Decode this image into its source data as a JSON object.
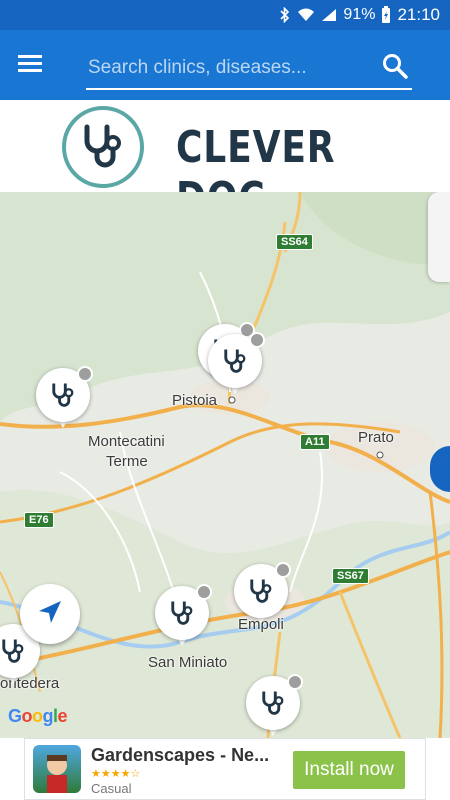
{
  "status_bar": {
    "battery": "91%",
    "time": "21:10",
    "icons": [
      "bluetooth-icon",
      "wifi-icon",
      "signal-icon",
      "battery-charging-icon"
    ]
  },
  "app_bar": {
    "menu_icon": "hamburger-menu-icon",
    "search_placeholder": "Search clinics, diseases...",
    "search_icon": "search-icon",
    "color": "#1976d2"
  },
  "logo": {
    "title": "CLEVER DOC",
    "accent": "#5aa7a6",
    "text_color": "#213748"
  },
  "map": {
    "places": [
      "Pistoia",
      "Prato",
      "Montecatini",
      "Terme",
      "Empoli",
      "San Miniato",
      "ontedera"
    ],
    "road_labels": [
      "SS64",
      "A11",
      "E76",
      "SS67"
    ],
    "markers": [
      {
        "icon": "stethoscope-icon",
        "status": "inactive"
      },
      {
        "icon": "stethoscope-icon",
        "status": "inactive"
      },
      {
        "icon": "stethoscope-icon",
        "status": "inactive"
      },
      {
        "icon": "stethoscope-icon",
        "status": "inactive"
      },
      {
        "icon": "stethoscope-icon",
        "status": "inactive"
      },
      {
        "icon": "stethoscope-icon",
        "status": "inactive"
      },
      {
        "icon": "stethoscope-icon",
        "status": "inactive"
      }
    ],
    "locate_icon": "navigation-arrow-icon",
    "attribution": "Google"
  },
  "ad": {
    "title": "Gardenscapes - Ne...",
    "category": "Casual",
    "rating_stars": "★★★★☆",
    "install_label": "Install now",
    "button_color": "#8bc34a"
  }
}
